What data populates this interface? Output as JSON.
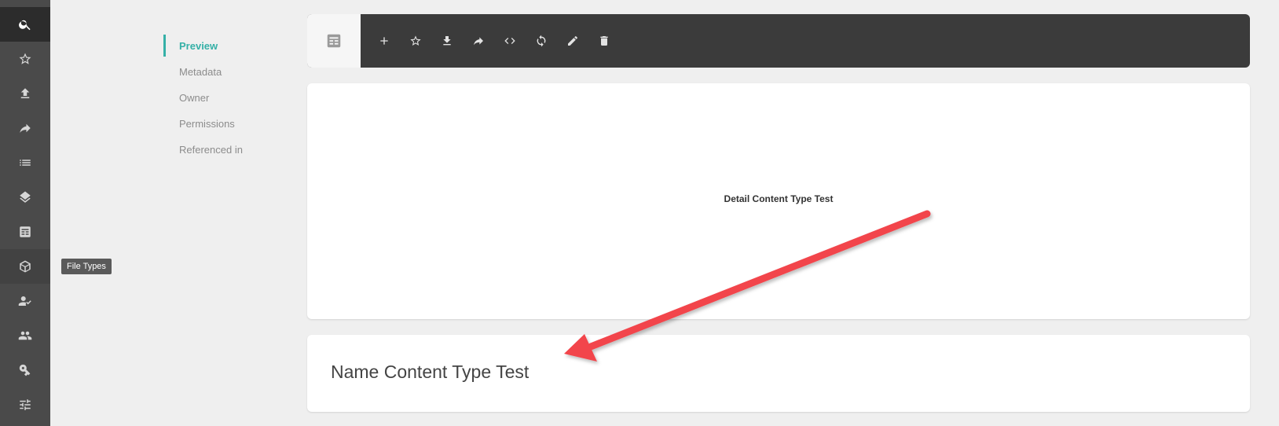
{
  "sidebar": {
    "items": [
      {
        "icon": "search-icon"
      },
      {
        "icon": "star-icon"
      },
      {
        "icon": "upload-icon"
      },
      {
        "icon": "share-icon"
      },
      {
        "icon": "list-icon"
      },
      {
        "icon": "layers-icon"
      },
      {
        "icon": "table-icon"
      },
      {
        "icon": "cube-icon"
      },
      {
        "icon": "person-check-icon"
      },
      {
        "icon": "group-icon"
      },
      {
        "icon": "key-icon"
      },
      {
        "icon": "tune-icon"
      }
    ],
    "tooltip": "File Types"
  },
  "subnav": {
    "items": [
      "Preview",
      "Metadata",
      "Owner",
      "Permissions",
      "Referenced in"
    ]
  },
  "toolbar": {
    "type_icon": "content-type-icon",
    "actions": [
      "add-icon",
      "star-icon",
      "download-icon",
      "share-icon",
      "code-icon",
      "sync-icon",
      "edit-icon",
      "delete-icon"
    ]
  },
  "preview": {
    "text": "Detail Content Type Test"
  },
  "name_card": {
    "title": "Name Content Type Test"
  },
  "annotation": {
    "arrow_color": "#f2444b"
  },
  "colors": {
    "accent": "#35b0a7",
    "rail": "#4a4a4a",
    "toolbar": "#3b3b3b"
  }
}
